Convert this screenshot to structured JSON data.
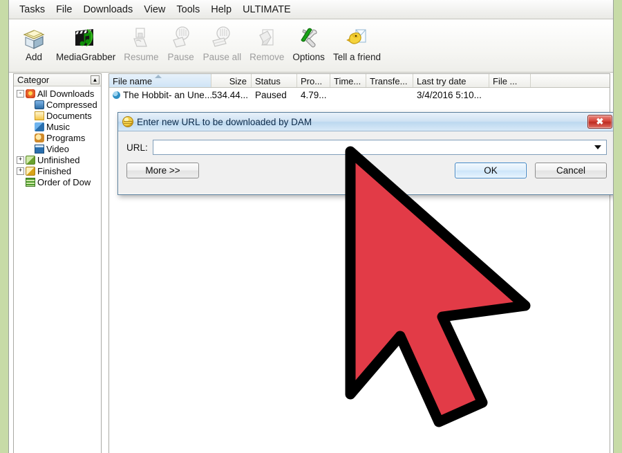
{
  "window": {
    "background_color": "#c7dba7",
    "frame_color": "#ffffff"
  },
  "menubar": {
    "items": [
      {
        "label": "Tasks",
        "name": "menu-tasks"
      },
      {
        "label": "File",
        "name": "menu-file"
      },
      {
        "label": "Downloads",
        "name": "menu-downloads"
      },
      {
        "label": "View",
        "name": "menu-view"
      },
      {
        "label": "Tools",
        "name": "menu-tools"
      },
      {
        "label": "Help",
        "name": "menu-help"
      },
      {
        "label": "ULTIMATE",
        "name": "menu-ultimate"
      }
    ]
  },
  "toolbar": {
    "buttons": [
      {
        "label": "Add",
        "icon": "add-folder-icon",
        "enabled": true
      },
      {
        "label": "MediaGrabber",
        "icon": "clapperboard-music-icon",
        "enabled": true
      },
      {
        "label": "Resume",
        "icon": "resume-icon",
        "enabled": false
      },
      {
        "label": "Pause",
        "icon": "pause-hand-icon",
        "enabled": false
      },
      {
        "label": "Pause all",
        "icon": "pause-all-hand-icon",
        "enabled": false
      },
      {
        "label": "Remove",
        "icon": "remove-eraser-icon",
        "enabled": false
      },
      {
        "label": "Options",
        "icon": "wrench-screwdriver-icon",
        "enabled": true
      },
      {
        "label": "Tell a friend",
        "icon": "bird-letter-icon",
        "enabled": true
      }
    ]
  },
  "sidebar": {
    "header_title": "Categor",
    "header_button_glyph": "▲",
    "tree": [
      {
        "label": "All Downloads",
        "expander": "-",
        "icon": "all-downloads-icon",
        "indent": 0,
        "name": "tree-item-all-downloads"
      },
      {
        "label": "Compressed",
        "expander": "",
        "icon": "compressed-icon",
        "indent": 1,
        "name": "tree-item-compressed"
      },
      {
        "label": "Documents",
        "expander": "",
        "icon": "documents-icon",
        "indent": 1,
        "name": "tree-item-documents"
      },
      {
        "label": "Music",
        "expander": "",
        "icon": "music-icon",
        "indent": 1,
        "name": "tree-item-music"
      },
      {
        "label": "Programs",
        "expander": "",
        "icon": "programs-icon",
        "indent": 1,
        "name": "tree-item-programs"
      },
      {
        "label": "Video",
        "expander": "",
        "icon": "video-icon",
        "indent": 1,
        "name": "tree-item-video"
      },
      {
        "label": "Unfinished",
        "expander": "+",
        "icon": "unfinished-icon",
        "indent": 0,
        "name": "tree-item-unfinished"
      },
      {
        "label": "Finished",
        "expander": "+",
        "icon": "finished-icon",
        "indent": 0,
        "name": "tree-item-finished"
      },
      {
        "label": "Order of Dow",
        "expander": "",
        "icon": "order-of-download-icon",
        "indent": 0,
        "name": "tree-item-order-of-download"
      }
    ]
  },
  "downloads_list": {
    "columns": [
      {
        "label": "File name",
        "width": 148,
        "sorted": true,
        "align": "left"
      },
      {
        "label": "Size",
        "width": 58,
        "sorted": false,
        "align": "right"
      },
      {
        "label": "Status",
        "width": 66,
        "sorted": false,
        "align": "left"
      },
      {
        "label": "Pro...",
        "width": 48,
        "sorted": false,
        "align": "left"
      },
      {
        "label": "Time...",
        "width": 52,
        "sorted": false,
        "align": "left"
      },
      {
        "label": "Transfe...",
        "width": 68,
        "sorted": false,
        "align": "left"
      },
      {
        "label": "Last try date",
        "width": 110,
        "sorted": false,
        "align": "left"
      },
      {
        "label": "File ...",
        "width": 60,
        "sorted": false,
        "align": "left"
      }
    ],
    "rows": [
      {
        "icon": "download-item-icon",
        "file_name": "The Hobbit- an Une...",
        "size": "534.44...",
        "status": "Paused",
        "progress": "4.79...",
        "time_left": "",
        "transfer_rate": "",
        "last_try_date": "3/4/2016 5:10...",
        "file_type": ""
      }
    ]
  },
  "dialog": {
    "title": "Enter new URL to be downloaded by DAM",
    "title_icon": "globe-icon",
    "close_glyph": "✖",
    "url_label": "URL:",
    "url_value": "",
    "url_placeholder": "",
    "dropdown_glyph": "▼",
    "buttons": {
      "more": "More >>",
      "ok": "OK",
      "cancel": "Cancel"
    }
  },
  "cursor": {
    "name": "mouse-pointer",
    "fill_color": "#e23b47",
    "outline_color": "#000000"
  }
}
